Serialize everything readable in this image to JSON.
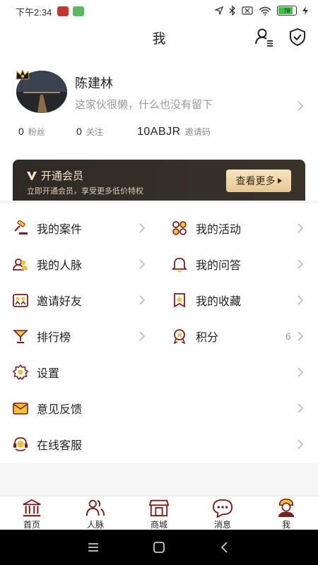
{
  "status_bar": {
    "time": "下午2:34",
    "battery": "78"
  },
  "header": {
    "title": "我"
  },
  "profile": {
    "name": "陈建林",
    "bio": "这家伙很懒，什么也没有留下"
  },
  "stats": [
    {
      "value": "0",
      "label": "粉丝"
    },
    {
      "value": "0",
      "label": "关注"
    },
    {
      "value": "10ABJR",
      "label": "邀请码"
    }
  ],
  "vip": {
    "title": "开通会员",
    "subtitle": "立即开通会员，享受更多低价特权",
    "button": "查看更多"
  },
  "menu_grid": [
    {
      "label": "我的案件",
      "icon": "gavel-icon"
    },
    {
      "label": "我的活动",
      "icon": "activity-icon"
    },
    {
      "label": "我的人脉",
      "icon": "contacts-icon"
    },
    {
      "label": "我的问答",
      "icon": "bell-icon"
    },
    {
      "label": "邀请好友",
      "icon": "invite-icon"
    },
    {
      "label": "我的收藏",
      "icon": "bookmark-star-icon"
    },
    {
      "label": "排行榜",
      "icon": "trophy-icon"
    },
    {
      "label": "积分",
      "icon": "medal-icon",
      "count": "6"
    }
  ],
  "menu_list": [
    {
      "label": "设置",
      "icon": "gear-icon"
    },
    {
      "label": "意见反馈",
      "icon": "envelope-icon"
    },
    {
      "label": "在线客服",
      "icon": "headset-icon"
    }
  ],
  "tabs": [
    {
      "label": "首页",
      "icon": "bank-icon"
    },
    {
      "label": "人脉",
      "icon": "people-icon"
    },
    {
      "label": "商城",
      "icon": "shop-icon"
    },
    {
      "label": "消息",
      "icon": "chat-icon"
    },
    {
      "label": "我",
      "icon": "user-icon",
      "active": true
    }
  ],
  "colors": {
    "accent": "#7a1f1f",
    "vip_bg": "#2f2a26",
    "vip_button": "#efd6a8",
    "icon_gold": "#d9a441"
  }
}
